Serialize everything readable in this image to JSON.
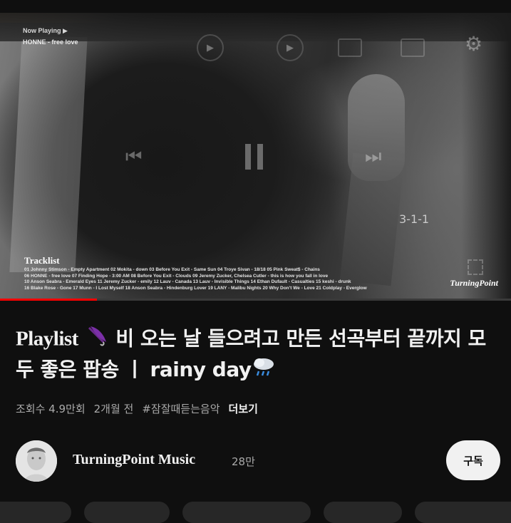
{
  "player": {
    "now_playing_label": "Now Playing ▶",
    "now_playing_track": "HONNE - free love",
    "tracklist_title": "Tracklist",
    "tracklist_lines": [
      "01 Johnny Stimson - Empty Apartment  02 Mokita - down  03 Before You Exit - Same Sun  04 Troye Sivan - 18/18  05 Pink Sweat$ - Chains",
      "06 HONNE - free love  07 Finding Hope - 3:00 AM  08 Before You Exit - Clouds  09 Jeremy Zucker, Chelsea Cutler - this is how you fall in love",
      "10 Anson Seabra - Emerald Eyes  11 Jeremy Zucker - emily  12 Lauv - Canada  13 Lauv - Invisible Things  14 Ethan Dufault - Casualties  15 keshi - drunk",
      "16 Blake Rose - Gone  17 Munn - I Lost Myself  18 Anson Seabra - Hindenburg Lover  19 LANY - Malibu Nights  20 Why Don't We - Love  21 Coldplay - Everglow"
    ],
    "watermark": "TurningPoint",
    "sign_text": "3-1-1",
    "progress_fraction": 0.19,
    "icons": [
      "autoplay-icon",
      "play-icon",
      "cast-icon",
      "captions-icon",
      "settings-gear-icon",
      "skip-previous-icon",
      "pause-icon",
      "skip-next-icon",
      "fullscreen-icon"
    ]
  },
  "video": {
    "title_en": "Playlist",
    "title_emoji": "umbrella",
    "title_ko": " 비 오는 날 들으려고 만든 선곡부터 끝까지 모두 좋은 팝송 ㅣ rainy day",
    "title_end_emoji": "cloud-with-rain"
  },
  "meta": {
    "views": "조회수 4.9만회",
    "age": "2개월 전",
    "hashtag": "#잠잘때듣는음악",
    "more": "더보기"
  },
  "channel": {
    "name": "TurningPoint Music",
    "subscribers": "28만",
    "subscribe_label": "구독"
  },
  "colors": {
    "background": "#0f0f0f",
    "progress": "#ff0000",
    "text_primary": "#f1f1f1",
    "text_secondary": "#aaaaaa",
    "subscribe_bg": "#f1f1f1"
  }
}
